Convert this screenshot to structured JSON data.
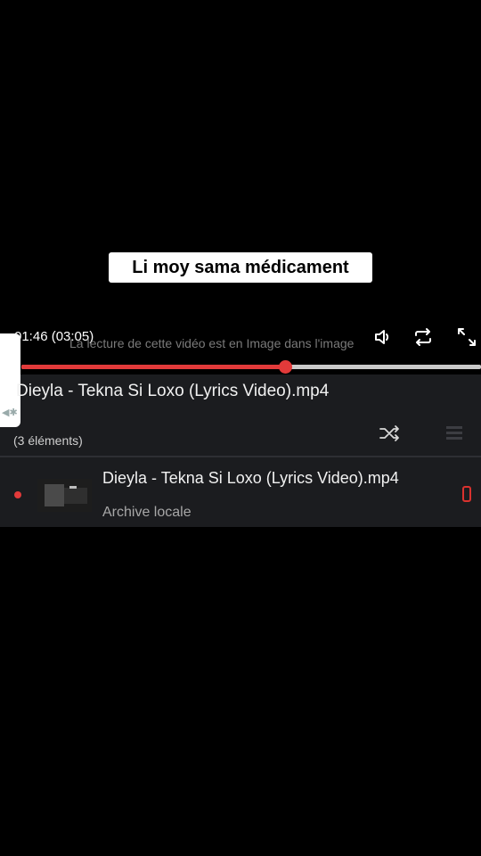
{
  "overlay": {
    "caption": "Li moy sama médicament"
  },
  "player": {
    "time_display": "01:46 (03:05)",
    "pip_message": "La lecture de cette vidéo est en Image dans l'image",
    "progress_fraction": 0.574,
    "accent_color": "#e23a3a",
    "icons": [
      "speaker-icon",
      "repeat-icon",
      "fullscreen-icon"
    ]
  },
  "now_playing": {
    "title": "Dieyla - Tekna Si Loxo (Lyrics Video).mp4",
    "count": "(3 éléments)",
    "icons": [
      "shuffle-icon",
      "queue-icon"
    ]
  },
  "playlist": {
    "items": [
      {
        "title": "Dieyla - Tekna Si Loxo (Lyrics Video).mp4",
        "subtitle": "Archive locale",
        "playing": true
      }
    ]
  }
}
